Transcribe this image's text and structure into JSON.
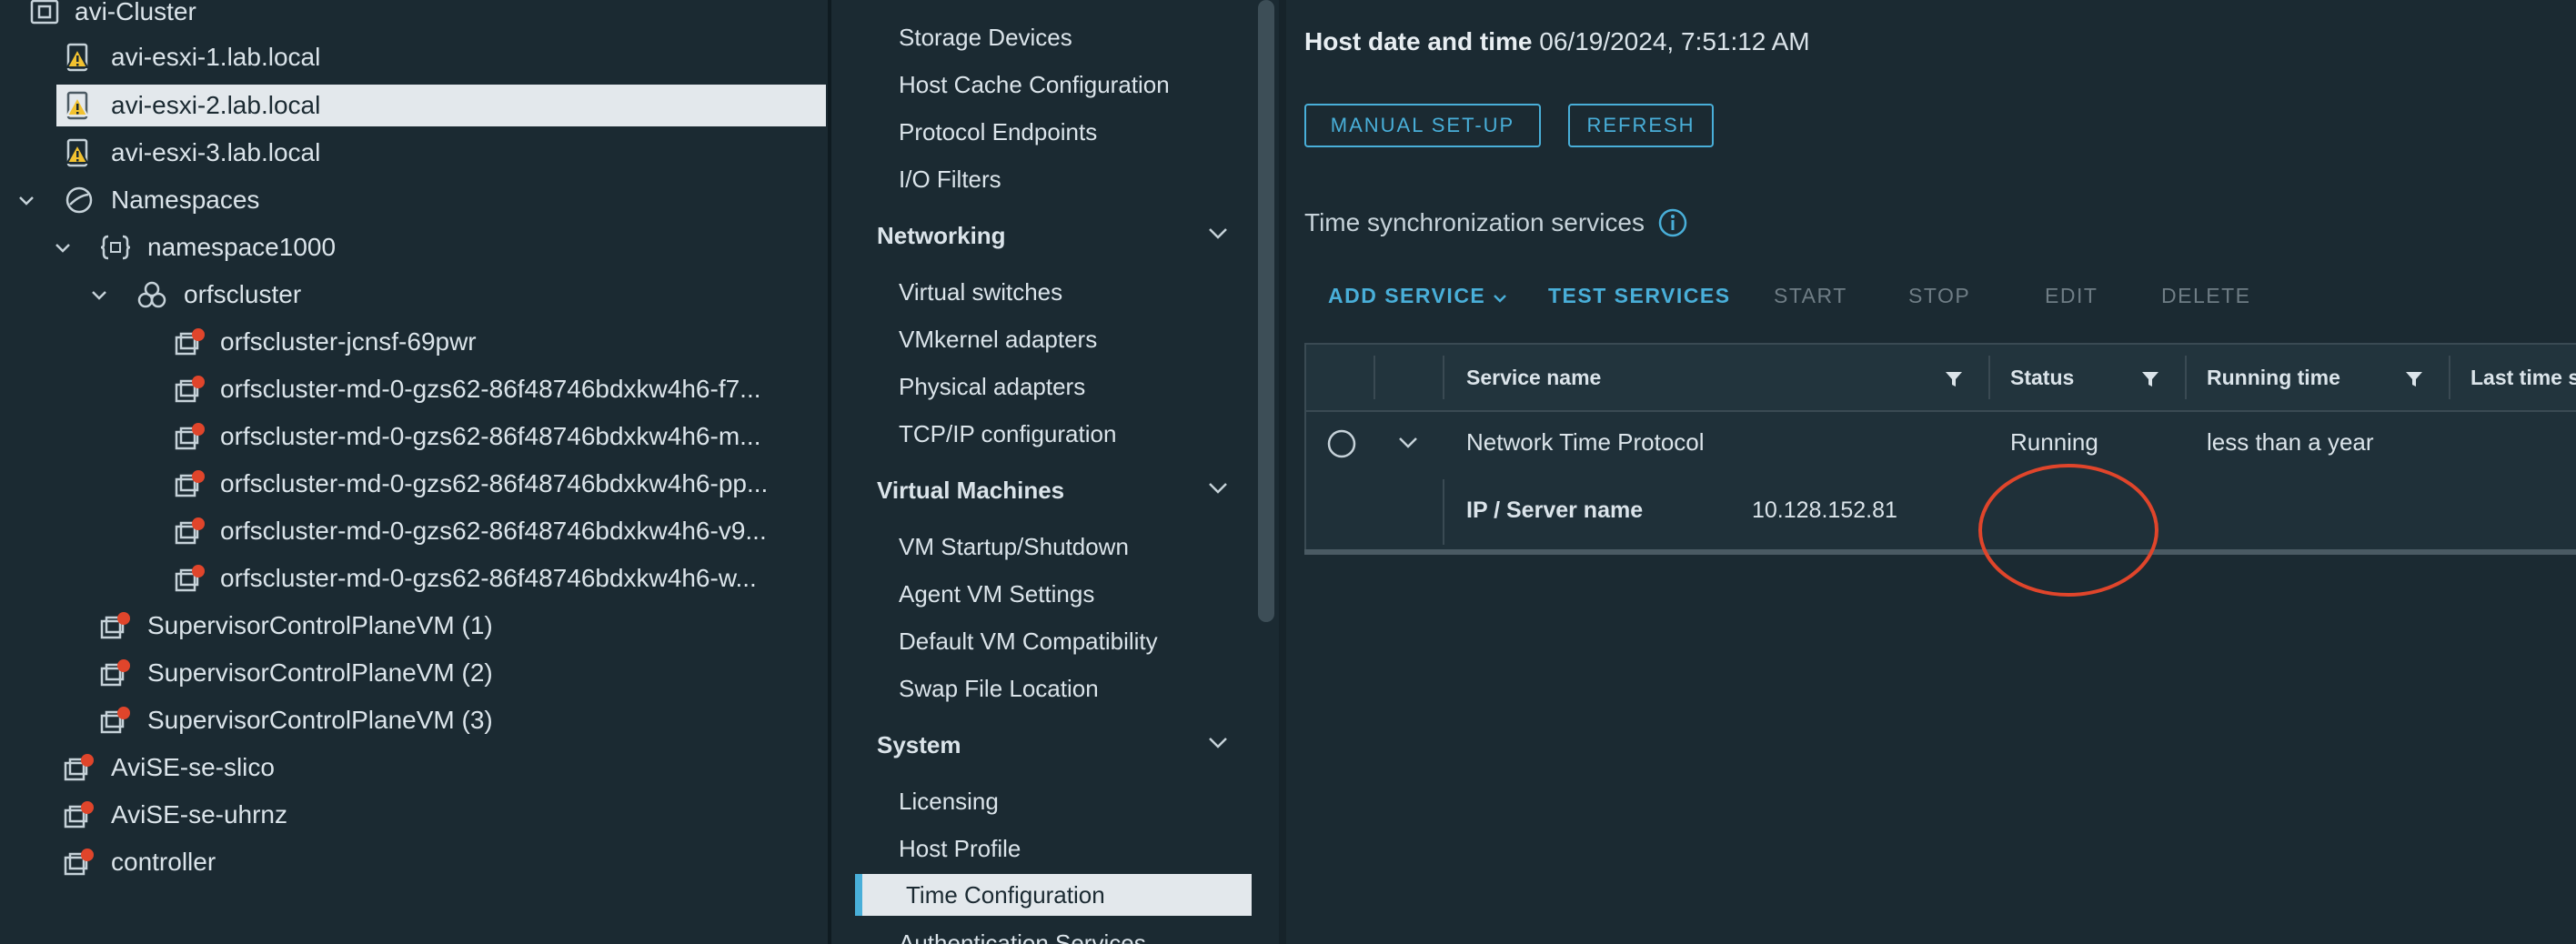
{
  "tree": {
    "items": [
      {
        "label": "avi-Cluster"
      },
      {
        "label": "avi-esxi-1.lab.local"
      },
      {
        "label": "avi-esxi-2.lab.local"
      },
      {
        "label": "avi-esxi-3.lab.local"
      },
      {
        "label": "Namespaces"
      },
      {
        "label": "namespace1000"
      },
      {
        "label": "orfscluster"
      },
      {
        "label": "orfscluster-jcnsf-69pwr"
      },
      {
        "label": "orfscluster-md-0-gzs62-86f48746bdxkw4h6-f7..."
      },
      {
        "label": "orfscluster-md-0-gzs62-86f48746bdxkw4h6-m..."
      },
      {
        "label": "orfscluster-md-0-gzs62-86f48746bdxkw4h6-pp..."
      },
      {
        "label": "orfscluster-md-0-gzs62-86f48746bdxkw4h6-v9..."
      },
      {
        "label": "orfscluster-md-0-gzs62-86f48746bdxkw4h6-w..."
      },
      {
        "label": "SupervisorControlPlaneVM (1)"
      },
      {
        "label": "SupervisorControlPlaneVM (2)"
      },
      {
        "label": "SupervisorControlPlaneVM (3)"
      },
      {
        "label": "AviSE-se-slico"
      },
      {
        "label": "AviSE-se-uhrnz"
      },
      {
        "label": "controller"
      }
    ],
    "selected": "avi-esxi-2.lab.local"
  },
  "nav": {
    "items": [
      {
        "label": "Storage Devices"
      },
      {
        "label": "Host Cache Configuration"
      },
      {
        "label": "Protocol Endpoints"
      },
      {
        "label": "I/O Filters"
      },
      {
        "label": "Networking"
      },
      {
        "label": "Virtual switches"
      },
      {
        "label": "VMkernel adapters"
      },
      {
        "label": "Physical adapters"
      },
      {
        "label": "TCP/IP configuration"
      },
      {
        "label": "Virtual Machines"
      },
      {
        "label": "VM Startup/Shutdown"
      },
      {
        "label": "Agent VM Settings"
      },
      {
        "label": "Default VM Compatibility"
      },
      {
        "label": "Swap File Location"
      },
      {
        "label": "System"
      },
      {
        "label": "Licensing"
      },
      {
        "label": "Host Profile"
      },
      {
        "label": "Time Configuration"
      },
      {
        "label": "Authentication Services"
      }
    ],
    "selected": "Time Configuration"
  },
  "content": {
    "host_dt_label": "Host date and time",
    "host_dt_value": "06/19/2024, 7:51:12 AM",
    "manual_setup": "MANUAL SET-UP",
    "refresh": "REFRESH",
    "sync_title": "Time synchronization services",
    "actions": {
      "add_service": "ADD SERVICE",
      "test_services": "TEST SERVICES",
      "start": "START",
      "stop": "STOP",
      "edit": "EDIT",
      "delete": "DELETE"
    },
    "grid": {
      "columns": [
        "Service name",
        "Status",
        "Running time",
        "Last time s"
      ],
      "row": {
        "service_name": "Network Time Protocol",
        "status": "Running",
        "running_time": "less than a year"
      },
      "detail_label": "IP / Server name",
      "detail_value": "10.128.152.81"
    },
    "annotation_color": "#e0452b",
    "accent_color": "#49afd9"
  }
}
